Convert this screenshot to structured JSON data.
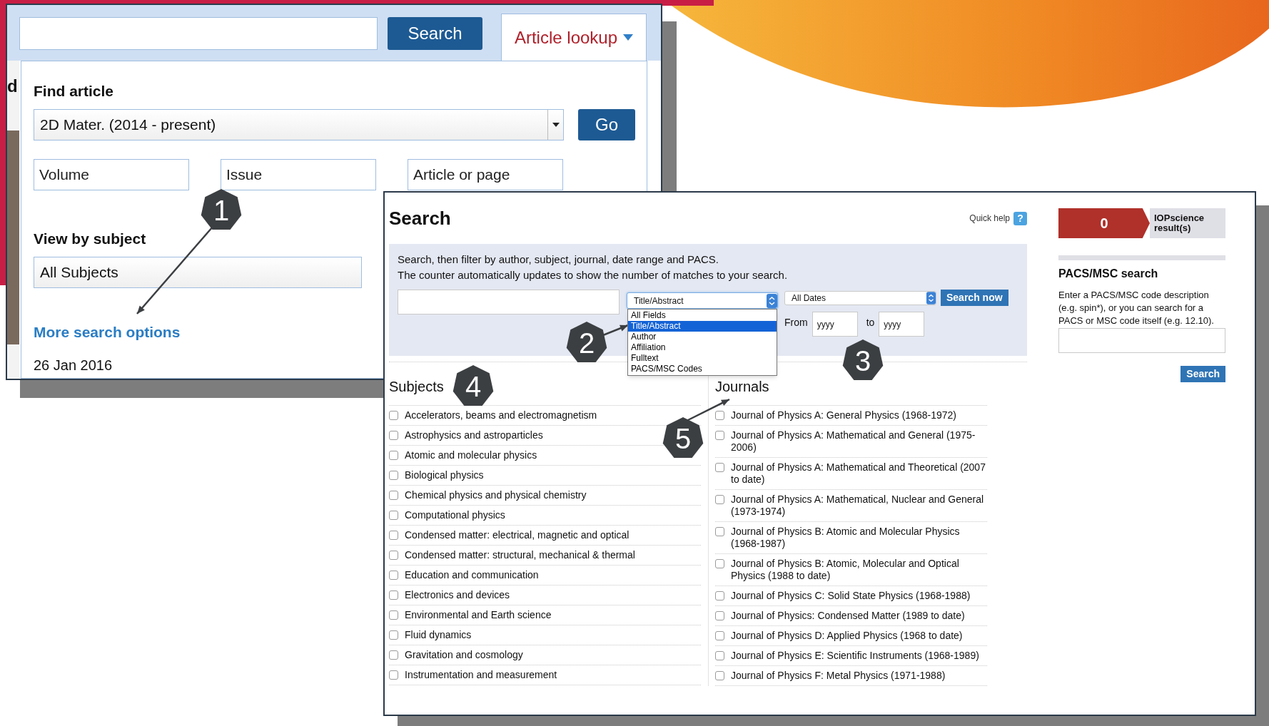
{
  "article_panel": {
    "search_button": "Search",
    "lookup_tab": {
      "label": "Article lookup",
      "selected": true
    },
    "edge_letter": "d",
    "find_article": {
      "title": "Find article",
      "journal_select": "2D Mater. (2014 - present)",
      "go_button": "Go",
      "fields": [
        {
          "placeholder": "Volume"
        },
        {
          "placeholder": "Issue"
        },
        {
          "placeholder": "Article or page"
        }
      ]
    },
    "view_by_subject": {
      "title": "View by subject",
      "subject_select": "All Subjects"
    },
    "more_link": "More search options",
    "date": "26 Jan 2016"
  },
  "search_panel": {
    "title": "Search",
    "quick_help": "Quick help",
    "help_icon": "?",
    "intro": [
      "Search, then filter by author, subject, journal, date range and PACS.",
      "The counter automatically updates to show the number of matches to your search."
    ],
    "field_select": {
      "value": "Title/Abstract",
      "expanded": true,
      "options": [
        {
          "label": "All Fields",
          "selected": false
        },
        {
          "label": "Title/Abstract",
          "selected": true
        },
        {
          "label": "Author",
          "selected": false
        },
        {
          "label": "Affiliation",
          "selected": false
        },
        {
          "label": "Fulltext",
          "selected": false
        },
        {
          "label": "PACS/MSC Codes",
          "selected": false
        }
      ]
    },
    "date_select": "All Dates",
    "search_now": "Search now",
    "from_label": "From",
    "from_placeholder": "yyyy",
    "to_label": "to",
    "to_placeholder": "yyyy",
    "subjects": {
      "title": "Subjects",
      "items": [
        {
          "label": "Accelerators, beams and electromagnetism",
          "checked": false
        },
        {
          "label": "Astrophysics and astroparticles",
          "checked": false
        },
        {
          "label": "Atomic and molecular physics",
          "checked": false
        },
        {
          "label": "Biological physics",
          "checked": false
        },
        {
          "label": "Chemical physics and physical chemistry",
          "checked": false
        },
        {
          "label": "Computational physics",
          "checked": false
        },
        {
          "label": "Condensed matter: electrical, magnetic and optical",
          "checked": false
        },
        {
          "label": "Condensed matter: structural, mechanical & thermal",
          "checked": false
        },
        {
          "label": "Education and communication",
          "checked": false
        },
        {
          "label": "Electronics and devices",
          "checked": false
        },
        {
          "label": "Environmental and Earth science",
          "checked": false
        },
        {
          "label": "Fluid dynamics",
          "checked": false
        },
        {
          "label": "Gravitation and cosmology",
          "checked": false
        },
        {
          "label": "Instrumentation and measurement",
          "checked": false
        }
      ]
    },
    "journals": {
      "title": "Journals",
      "items": [
        {
          "label": "Journal of Physics A: General Physics (1968-1972)",
          "checked": false
        },
        {
          "label": "Journal of Physics A: Mathematical and General (1975-2006)",
          "checked": false
        },
        {
          "label": "Journal of Physics A: Mathematical and Theoretical (2007 to date)",
          "checked": false
        },
        {
          "label": "Journal of Physics A: Mathematical, Nuclear and General (1973-1974)",
          "checked": false
        },
        {
          "label": "Journal of Physics B: Atomic and Molecular Physics (1968-1987)",
          "checked": false
        },
        {
          "label": "Journal of Physics B: Atomic, Molecular and Optical Physics (1988 to date)",
          "checked": false
        },
        {
          "label": "Journal of Physics C: Solid State Physics (1968-1988)",
          "checked": false
        },
        {
          "label": "Journal of Physics: Condensed Matter (1989 to date)",
          "checked": false
        },
        {
          "label": "Journal of Physics D: Applied Physics (1968 to date)",
          "checked": false
        },
        {
          "label": "Journal of Physics E: Scientific Instruments (1968-1989)",
          "checked": false
        },
        {
          "label": "Journal of Physics F: Metal Physics (1971-1988)",
          "checked": false
        }
      ]
    },
    "counter": {
      "count": "0",
      "label": "IOPscience result(s)"
    },
    "pacs": {
      "title": "PACS/MSC search",
      "text": "Enter a PACS/MSC code description (e.g. spin*), or you can search for a PACS or MSC code itself (e.g. 12.10).",
      "search_button": "Search"
    }
  },
  "annotations": [
    {
      "label": "1"
    },
    {
      "label": "2"
    },
    {
      "label": "3"
    },
    {
      "label": "4"
    },
    {
      "label": "5"
    }
  ]
}
